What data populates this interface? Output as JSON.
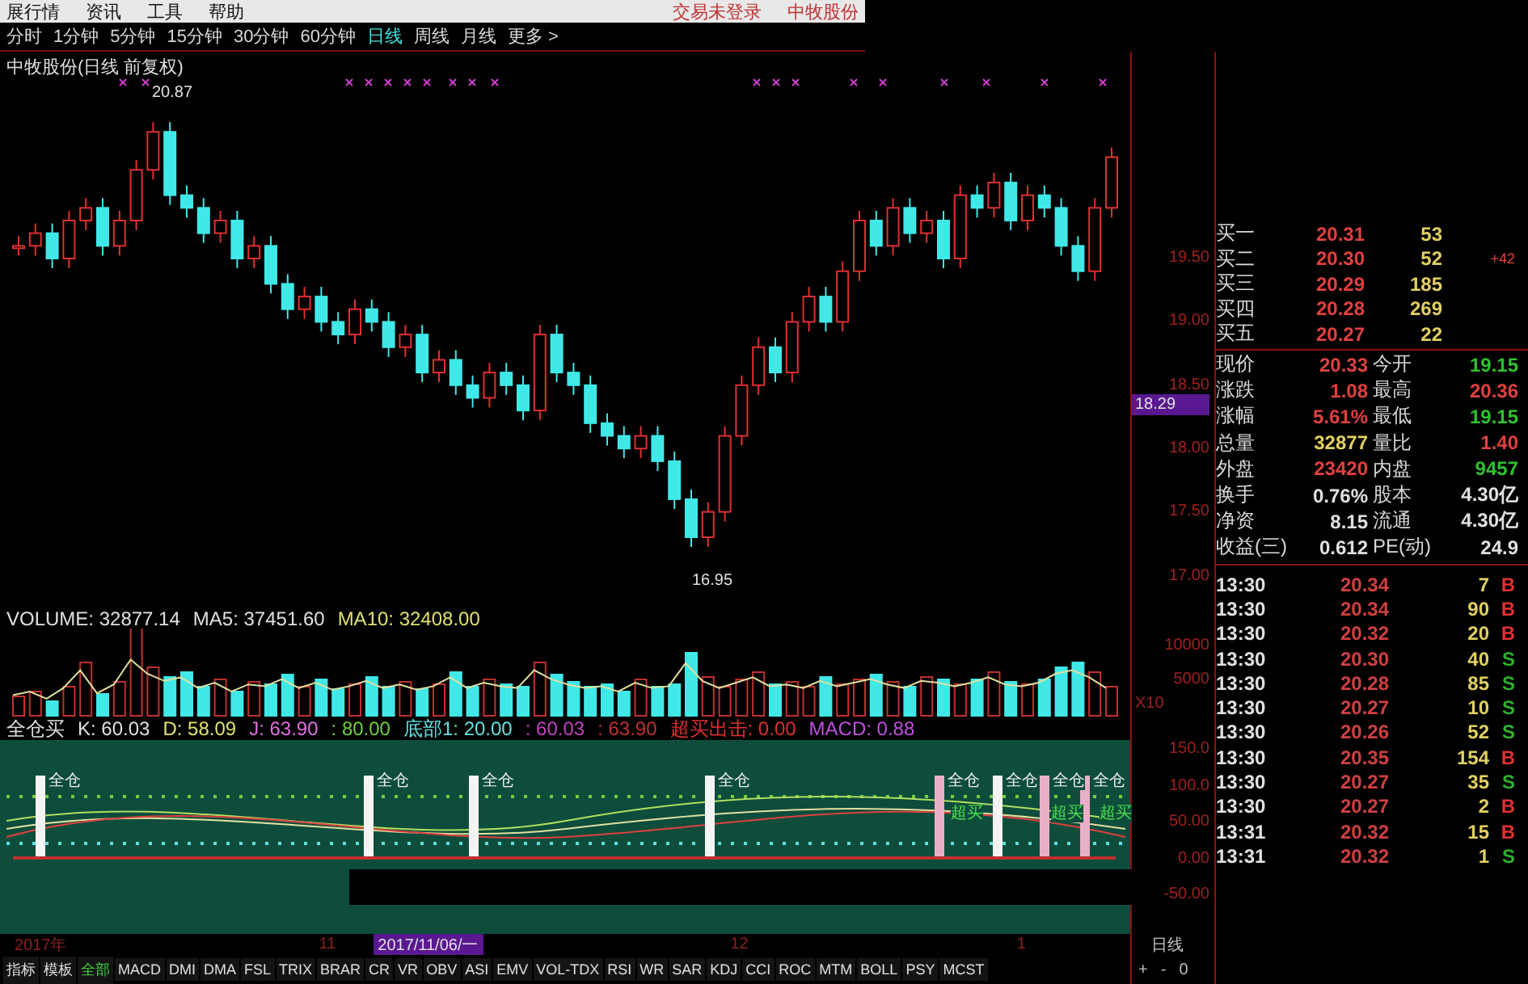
{
  "menu": {
    "items": [
      "展行情",
      "资讯",
      "工具",
      "帮助"
    ],
    "status": [
      "交易未登录",
      "中牧股份"
    ]
  },
  "periods": [
    {
      "label": "分时",
      "selected": false
    },
    {
      "label": "1分钟",
      "selected": false
    },
    {
      "label": "5分钟",
      "selected": false
    },
    {
      "label": "15分钟",
      "selected": false
    },
    {
      "label": "30分钟",
      "selected": false
    },
    {
      "label": "60分钟",
      "selected": false
    },
    {
      "label": "日线",
      "selected": true
    },
    {
      "label": "周线",
      "selected": false
    },
    {
      "label": "月线",
      "selected": false
    },
    {
      "label": "更多 >",
      "selected": false
    }
  ],
  "price_chart": {
    "title": "中牧股份(日线 前复权)",
    "high_label": "20.87",
    "low_label": "16.95",
    "axis": [
      "19.50",
      "19.00",
      "18.50",
      "18.00",
      "17.50",
      "17.00"
    ],
    "cursor_price": "18.29"
  },
  "volume": {
    "legend": [
      {
        "text": "VOLUME: 32877.14",
        "color": "#e0e0e0"
      },
      {
        "text": "MA5: 37451.60",
        "color": "#e0e0e0"
      },
      {
        "text": "MA10: 32408.00",
        "color": "#e0e070"
      }
    ],
    "axis": [
      "10000",
      "5000"
    ],
    "unit": "X10"
  },
  "indicator": {
    "legend": [
      {
        "text": "全仓买",
        "color": "#e0e0e0"
      },
      {
        "text": "K: 60.03",
        "color": "#e0e0e0"
      },
      {
        "text": "D: 58.09",
        "color": "#e0e070"
      },
      {
        "text": "J: 63.90",
        "color": "#e070e0"
      },
      {
        "text": ": 80.00",
        "color": "#70d040"
      },
      {
        "text": "底部1: 20.00",
        "color": "#60e0e0"
      },
      {
        "text": ": 60.03",
        "color": "#c040c0"
      },
      {
        "text": ": 63.90",
        "color": "#c03030"
      },
      {
        "text": "超买出击: 0.00",
        "color": "#e03030"
      },
      {
        "text": "MACD: 0.88",
        "color": "#c050e0"
      }
    ],
    "signals": [
      "全仓",
      "全仓",
      "全仓",
      "全仓",
      "全仓",
      "全仓",
      "全仓",
      "全仓"
    ],
    "overbought": [
      "超买",
      "超买",
      "超买"
    ],
    "axis": [
      "150.0",
      "100.0",
      "50.00",
      "0.00",
      "-50.00"
    ]
  },
  "dates": [
    {
      "label": "2017年",
      "selected": false
    },
    {
      "label": "11",
      "selected": false
    },
    {
      "label": "2017/11/06/一",
      "selected": true
    },
    {
      "label": "12",
      "selected": false
    },
    {
      "label": "1",
      "selected": false
    }
  ],
  "period_label": "日线",
  "zoom_controls": [
    "+",
    "-",
    "0"
  ],
  "bottom_tabs": [
    {
      "label": "指标",
      "selected": false
    },
    {
      "label": "模板",
      "selected": false
    },
    {
      "label": "全部",
      "selected": true
    },
    {
      "label": "MACD",
      "selected": false
    },
    {
      "label": "DMI",
      "selected": false
    },
    {
      "label": "DMA",
      "selected": false
    },
    {
      "label": "FSL",
      "selected": false
    },
    {
      "label": "TRIX",
      "selected": false
    },
    {
      "label": "BRAR",
      "selected": false
    },
    {
      "label": "CR",
      "selected": false
    },
    {
      "label": "VR",
      "selected": false
    },
    {
      "label": "OBV",
      "selected": false
    },
    {
      "label": "ASI",
      "selected": false
    },
    {
      "label": "EMV",
      "selected": false
    },
    {
      "label": "VOL-TDX",
      "selected": false
    },
    {
      "label": "RSI",
      "selected": false
    },
    {
      "label": "WR",
      "selected": false
    },
    {
      "label": "SAR",
      "selected": false
    },
    {
      "label": "KDJ",
      "selected": false
    },
    {
      "label": "CCI",
      "selected": false
    },
    {
      "label": "ROC",
      "selected": false
    },
    {
      "label": "MTM",
      "selected": false
    },
    {
      "label": "BOLL",
      "selected": false
    },
    {
      "label": "PSY",
      "selected": false
    },
    {
      "label": "MCST",
      "selected": false
    }
  ],
  "order_book": [
    {
      "label": "买一",
      "price": "20.31",
      "volume": "53"
    },
    {
      "label": "买二",
      "price": "20.30",
      "volume": "52",
      "change": "+42"
    },
    {
      "label": "买三",
      "price": "20.29",
      "volume": "185"
    },
    {
      "label": "买四",
      "price": "20.28",
      "volume": "269"
    },
    {
      "label": "买五",
      "price": "20.27",
      "volume": "22"
    }
  ],
  "stats": [
    {
      "label": "现价",
      "value": "20.33",
      "color": "#e04040"
    },
    {
      "label": "今开",
      "value": "19.15",
      "color": "#30c030"
    },
    {
      "label": "涨跌",
      "value": "1.08",
      "color": "#e04040"
    },
    {
      "label": "最高",
      "value": "20.36",
      "color": "#e04040"
    },
    {
      "label": "涨幅",
      "value": "5.61%",
      "color": "#e04040"
    },
    {
      "label": "最低",
      "value": "19.15",
      "color": "#30c030"
    },
    {
      "label": "总量",
      "value": "32877",
      "color": "#e0d060"
    },
    {
      "label": "量比",
      "value": "1.40",
      "color": "#e04040"
    },
    {
      "label": "外盘",
      "value": "23420",
      "color": "#e04040"
    },
    {
      "label": "内盘",
      "value": "9457",
      "color": "#30c030"
    },
    {
      "label": "换手",
      "value": "0.76%",
      "color": "#e0e0e0"
    },
    {
      "label": "股本",
      "value": "4.30亿",
      "color": "#e0e0e0"
    },
    {
      "label": "净资",
      "value": "8.15",
      "color": "#e0e0e0"
    },
    {
      "label": "流通",
      "value": "4.30亿",
      "color": "#e0e0e0"
    },
    {
      "label": "收益(三)",
      "value": "0.612",
      "color": "#e0e0e0"
    },
    {
      "label": "PE(动)",
      "value": "24.9",
      "color": "#e0e0e0"
    }
  ],
  "ticks": [
    {
      "time": "13:30",
      "price": "20.34",
      "volume": "7",
      "side": "B",
      "kind": "buy"
    },
    {
      "time": "13:30",
      "price": "20.34",
      "volume": "90",
      "side": "B",
      "kind": "buy"
    },
    {
      "time": "13:30",
      "price": "20.32",
      "volume": "20",
      "side": "B",
      "kind": "buy"
    },
    {
      "time": "13:30",
      "price": "20.30",
      "volume": "40",
      "side": "S",
      "kind": "sell"
    },
    {
      "time": "13:30",
      "price": "20.28",
      "volume": "85",
      "side": "S",
      "kind": "sell"
    },
    {
      "time": "13:30",
      "price": "20.27",
      "volume": "10",
      "side": "S",
      "kind": "sell"
    },
    {
      "time": "13:30",
      "price": "20.26",
      "volume": "52",
      "side": "S",
      "kind": "sell"
    },
    {
      "time": "13:30",
      "price": "20.35",
      "volume": "154",
      "side": "B",
      "kind": "buy"
    },
    {
      "time": "13:30",
      "price": "20.27",
      "volume": "35",
      "side": "S",
      "kind": "sell"
    },
    {
      "time": "13:30",
      "price": "20.27",
      "volume": "2",
      "side": "B",
      "kind": "buy"
    },
    {
      "time": "13:31",
      "price": "20.32",
      "volume": "15",
      "side": "B",
      "kind": "buy"
    },
    {
      "time": "13:31",
      "price": "20.32",
      "volume": "1",
      "side": "S",
      "kind": "sell"
    }
  ]
}
